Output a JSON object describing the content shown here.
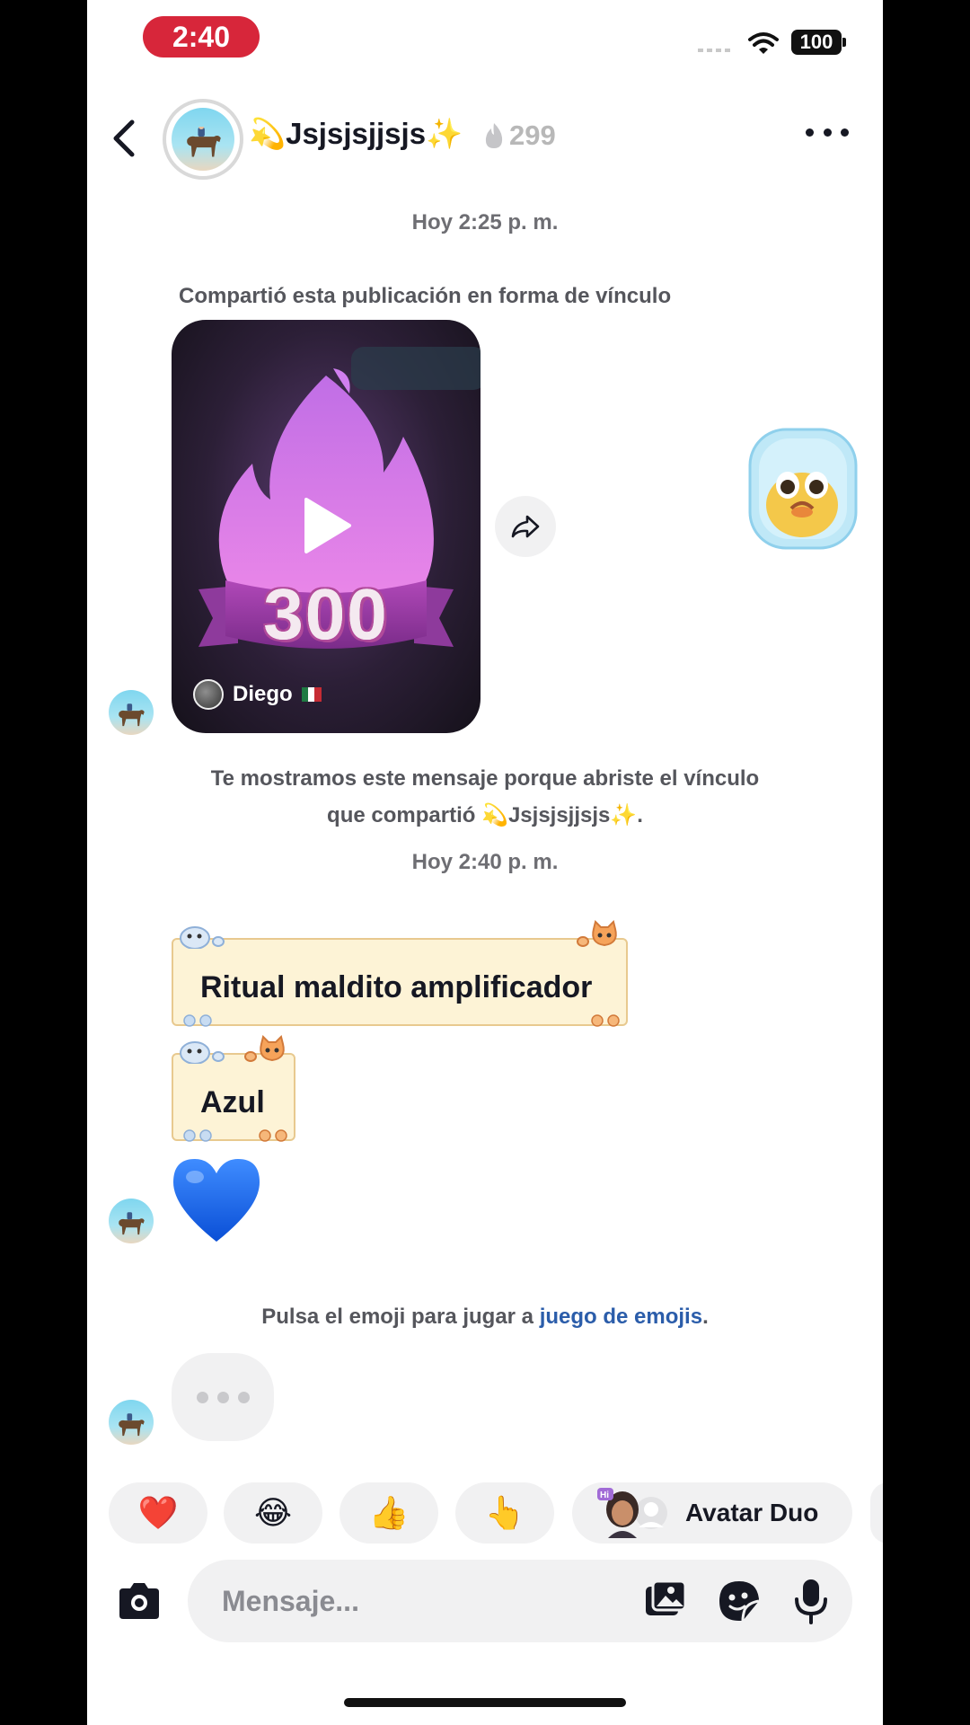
{
  "status_bar": {
    "time": "2:40",
    "battery": "100"
  },
  "header": {
    "contact_name": "💫Jsjsjsjjsjs✨",
    "streak_count": "299"
  },
  "messages": {
    "timestamp_1": "Hoy 2:25 p. m.",
    "shared_label": "Compartió esta publicación en forma de vínculo",
    "video": {
      "author": "Diego",
      "author_flag": "mexico-flag",
      "badge_number": "300"
    },
    "link_note_line1": "Te mostramos este mensaje porque abriste el vínculo",
    "link_note_line2": "que compartió 💫Jsjsjsjjsjs✨.",
    "timestamp_2": "Hoy 2:40 p. m.",
    "msg_1": "Ritual maldito amplificador",
    "msg_2": "Azul",
    "heart": "💙",
    "emoji_game_prefix": "Pulsa el emoji para jugar a ",
    "emoji_game_link": "juego de emojis",
    "emoji_game_suffix": "."
  },
  "quick_replies": [
    {
      "emoji": "❤️"
    },
    {
      "emoji": "😂"
    },
    {
      "emoji": "👍"
    },
    {
      "emoji": "👆"
    }
  ],
  "avatar_duo": {
    "label": "Avatar Duo",
    "hi_badge": "Hi"
  },
  "composer": {
    "placeholder": "Mensaje..."
  },
  "colors": {
    "accent_link": "#2b5daa",
    "status_time_bg": "#d7263a",
    "scroll_bg": "#fdf3d6"
  }
}
